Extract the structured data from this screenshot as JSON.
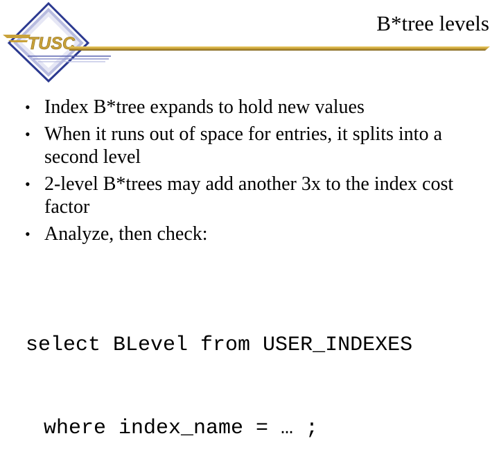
{
  "logo": {
    "text": "TUSC",
    "colors": {
      "gold": "#C9A23A",
      "navy": "#2B3990",
      "lavender": "#B8BCE0"
    }
  },
  "slide": {
    "title": "B*tree levels",
    "bullets": [
      {
        "marker": "•",
        "text": "Index B*tree expands to hold new values"
      },
      {
        "marker": "•",
        "text": "When it runs out of space for entries, it splits into a second level"
      },
      {
        "marker": "•",
        "text": "2-level B*trees may add another 3x to the index cost factor"
      },
      {
        "marker": "•",
        "text": "Analyze, then check:"
      }
    ],
    "code": {
      "line1": "select BLevel from USER_INDEXES",
      "line2": "where index_name = … ;"
    }
  }
}
